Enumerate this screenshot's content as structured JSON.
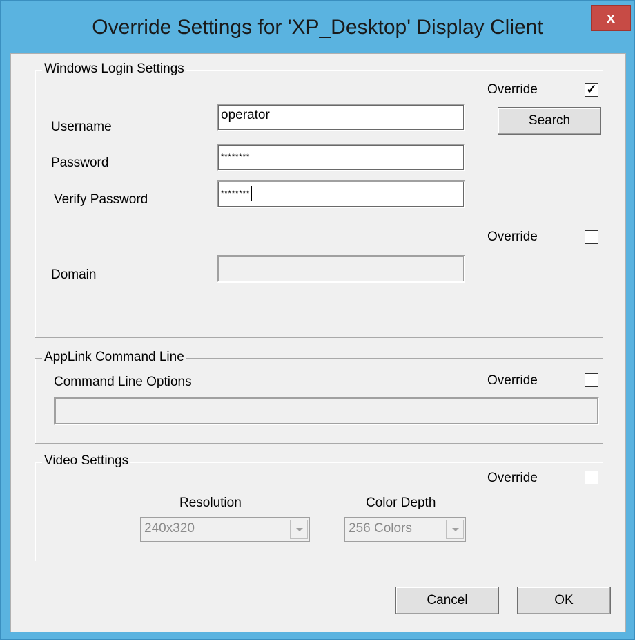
{
  "window": {
    "title": "Override Settings for 'XP_Desktop' Display Client",
    "close_label": "x"
  },
  "login": {
    "legend": "Windows Login Settings",
    "override_label": "Override",
    "override_checked": true,
    "username_label": "Username",
    "username_value": "operator",
    "search_label": "Search",
    "password_label": "Password",
    "password_value": "********",
    "verify_label": "Verify Password",
    "verify_value": "********",
    "override2_label": "Override",
    "override2_checked": false,
    "domain_label": "Domain",
    "domain_value": ""
  },
  "applink": {
    "legend": "AppLink Command Line",
    "options_label": "Command Line Options",
    "override_label": "Override",
    "override_checked": false,
    "options_value": ""
  },
  "video": {
    "legend": "Video Settings",
    "override_label": "Override",
    "override_checked": false,
    "resolution_label": "Resolution",
    "resolution_value": "240x320",
    "depth_label": "Color Depth",
    "depth_value": "256 Colors"
  },
  "footer": {
    "cancel_label": "Cancel",
    "ok_label": "OK"
  }
}
